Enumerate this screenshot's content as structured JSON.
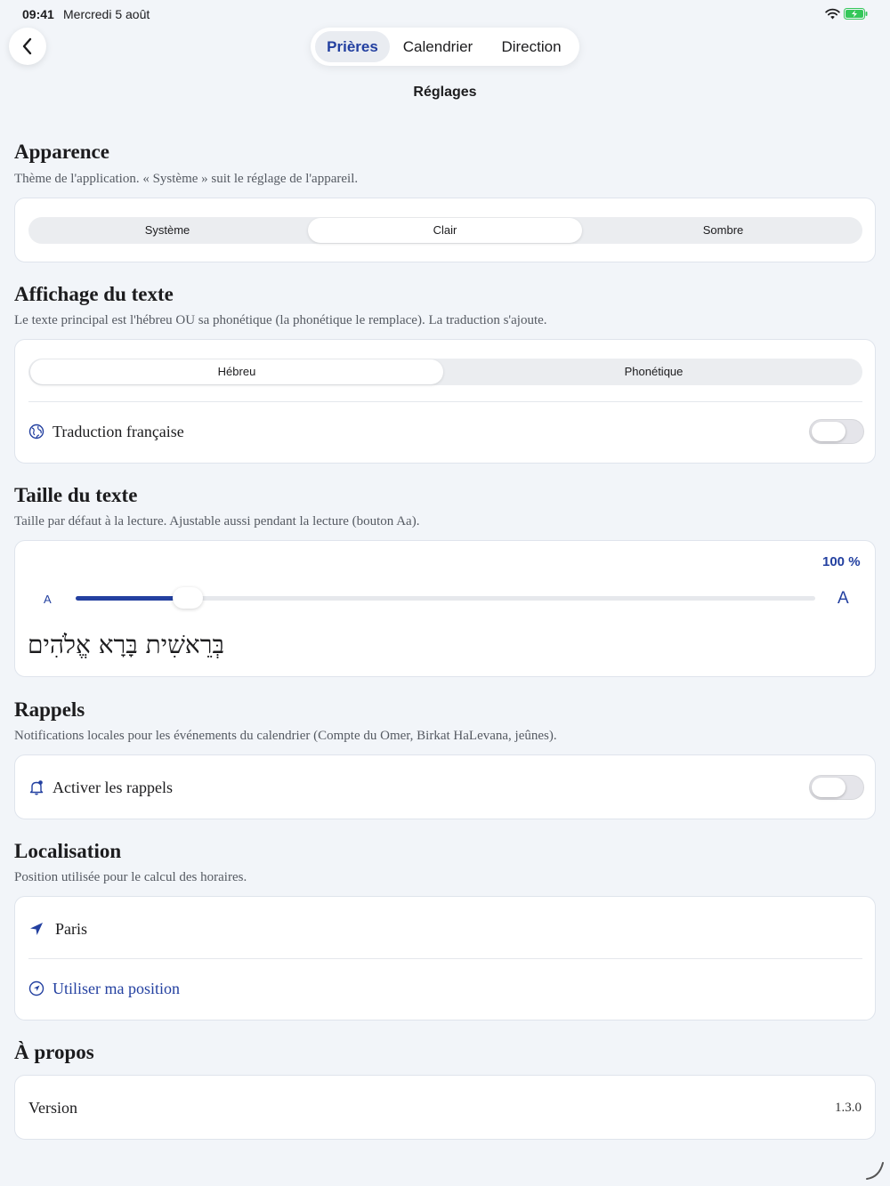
{
  "status_bar": {
    "time": "09:41",
    "date": "Mercredi 5 août"
  },
  "nav": {
    "tabs": [
      {
        "label": "Prières",
        "active": true
      },
      {
        "label": "Calendrier",
        "active": false
      },
      {
        "label": "Direction",
        "active": false
      }
    ],
    "title": "Réglages"
  },
  "appearance": {
    "title": "Apparence",
    "description": "Thème de l'application. « Système » suit le réglage de l'appareil.",
    "options": [
      "Système",
      "Clair",
      "Sombre"
    ],
    "selected": "Clair"
  },
  "text_display": {
    "title": "Affichage du texte",
    "description": "Le texte principal est l'hébreu OU sa phonétique (la phonétique le remplace). La traduction s'ajoute.",
    "options": [
      "Hébreu",
      "Phonétique"
    ],
    "selected": "Hébreu",
    "translation_label": "Traduction française",
    "translation_enabled": false
  },
  "text_size": {
    "title": "Taille du texte",
    "description": "Taille par défaut à la lecture. Ajustable aussi pendant la lecture (bouton Aa).",
    "percent_label": "100 %",
    "slider_fraction": 0.15,
    "small_a": "A",
    "large_a": "A",
    "preview": "בְּרֵאשִׁית בָּרָא אֱלֹהִים"
  },
  "reminders": {
    "title": "Rappels",
    "description": "Notifications locales pour les événements du calendrier (Compte du Omer, Birkat HaLevana, jeûnes).",
    "toggle_label": "Activer les rappels",
    "enabled": false
  },
  "location": {
    "title": "Localisation",
    "description": "Position utilisée pour le calcul des horaires.",
    "city": "Paris",
    "use_position_label": "Utiliser ma position"
  },
  "about": {
    "title": "À propos",
    "version_label": "Version",
    "version_value": "1.3.0"
  },
  "colors": {
    "accent": "#2340a0",
    "background": "#f2f5f9",
    "battery": "#34c759"
  }
}
